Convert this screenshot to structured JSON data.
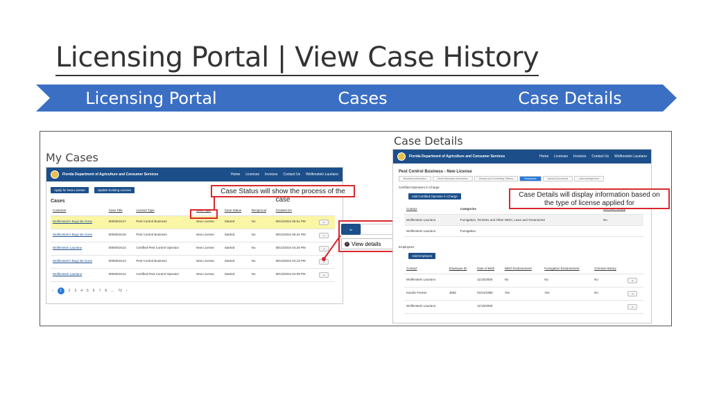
{
  "slide_title": "Licensing Portal | View Case History",
  "steps": [
    "Licensing Portal",
    "Cases",
    "Case Details"
  ],
  "left_panel": {
    "label": "My Cases",
    "org": "Florida Department of Agriculture and Consumer Services",
    "nav": [
      "Home",
      "Licenses",
      "Invoices",
      "Contact Us",
      "Wolfenstein Lauriano"
    ],
    "btn_apply": "Apply for New License",
    "btn_update": "Update Existing License",
    "section": "Cases",
    "columns": [
      "Customer",
      "Case Title",
      "License Type",
      "Case Type",
      "Case Status",
      "Reciprocal",
      "Created On"
    ],
    "rows": [
      [
        "Wolfenstein's Bugz Be Gone",
        "0000002417",
        "Pest Control Business",
        "New License",
        "Started",
        "No",
        "08/12/2024 05:51 PM"
      ],
      [
        "Wolfenstein's Bugz Be Gone",
        "0000002416",
        "Pest Control Business",
        "New License",
        "Started",
        "No",
        "08/12/2024 05:24 PM"
      ],
      [
        "Wolfenstein Lauriano",
        "0000002414",
        "Certified Pest Control Operator",
        "New License",
        "Started",
        "No",
        "08/13/2024 04:29 PM"
      ],
      [
        "Wolfenstein's Bugz Be Gone",
        "0000002413",
        "Pest Control Business",
        "New License",
        "Started",
        "No",
        "08/13/2024 04:19 PM"
      ],
      [
        "Wolfenstein Lauriano",
        "0000002412",
        "Certified Pest Control Operator",
        "New License",
        "Started",
        "No",
        "08/13/2024 04:09 PM"
      ]
    ],
    "pages": [
      "‹",
      "1",
      "2",
      "3",
      "4",
      "5",
      "6",
      "7",
      "8",
      "...",
      "72",
      "›"
    ],
    "callout": "Case Status will show the process of the case",
    "view_details": "View details"
  },
  "right_panel": {
    "label": "Case Details",
    "org": "Florida Department of Agriculture and Consumer Services",
    "nav": [
      "Home",
      "Licenses",
      "Invoices",
      "Contact Us",
      "Wolfenstein Lauriano"
    ],
    "title": "Pest Control Business - New License",
    "tabs": [
      "Business Information",
      "Owner Business Information",
      "Owners and Controlling Officers",
      "Employees",
      "Upload Documents",
      "Acknowledgement"
    ],
    "certified_label": "Certified Operators in Charge",
    "btn_add_coic": "Add Certified Operator in Charge",
    "coic_columns": [
      "Contact",
      "Categories",
      "Criminal History"
    ],
    "coic_rows": [
      [
        "Wolfenstein Lauriano",
        "Fumigation, Termites and Other WDO, Lawn and Ornamental",
        "No"
      ],
      [
        "Wolfenstein Lauriano",
        "Fumigation",
        ""
      ]
    ],
    "employees_label": "Employees",
    "btn_add_emp": "Add Employee",
    "emp_columns": [
      "Contact",
      "Employee ID",
      "Date of Birth",
      "WDO Endorsement",
      "Fumigation Endorsement",
      "Criminal History"
    ],
    "emp_rows": [
      [
        "Wolfenstein Lauriano",
        "",
        "11/15/2000",
        "No",
        "No",
        "No"
      ],
      [
        "Karolin Fenner",
        "JE55",
        "01/01/1980",
        "Yes",
        "Yes",
        "No"
      ],
      [
        "Wolfenstein Lauriano",
        "",
        "11/15/2000",
        "",
        "",
        ""
      ]
    ],
    "callout": "Case Details will display information based on the type of license applied for"
  }
}
